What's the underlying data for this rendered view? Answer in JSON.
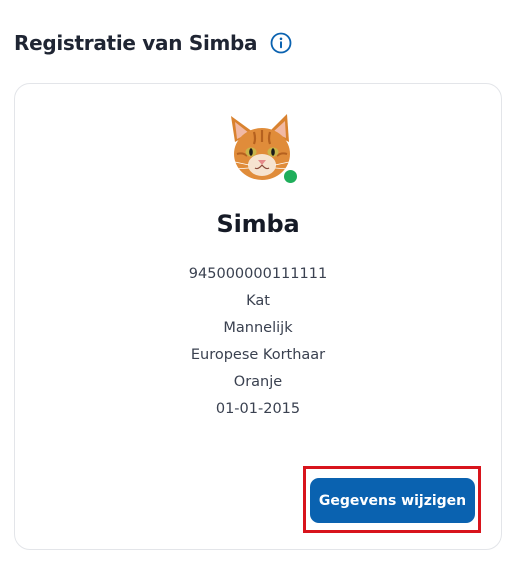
{
  "header": {
    "title": "Registratie van Simba",
    "info_icon": "info-circle-icon"
  },
  "pet": {
    "name": "Simba",
    "status_color": "#1fae5b",
    "details": [
      "945000000111111",
      "Kat",
      "Mannelijk",
      "Europese Korthaar",
      "Oranje",
      "01-01-2015"
    ]
  },
  "actions": {
    "edit_label": "Gegevens wijzigen"
  },
  "colors": {
    "accent": "#0a62b0",
    "highlight": "#d8141c",
    "status_online": "#1fae5b"
  }
}
